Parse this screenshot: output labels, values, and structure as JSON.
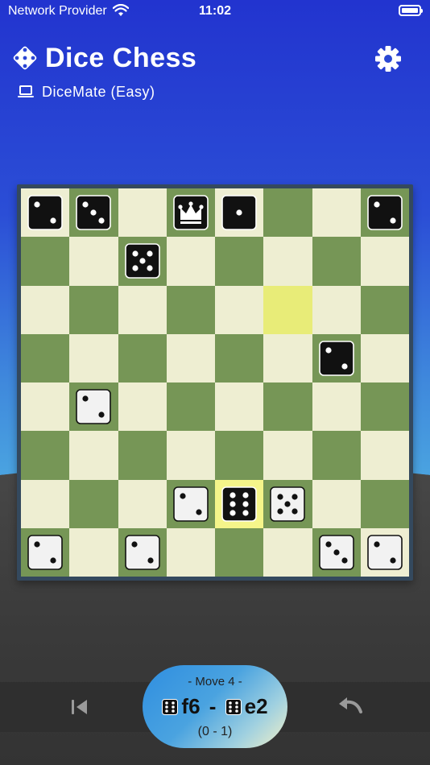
{
  "status_bar": {
    "carrier": "Network Provider",
    "time": "11:02"
  },
  "header": {
    "title": "Dice Chess",
    "opponent": "DiceMate (Easy)"
  },
  "colors": {
    "light_square": "#eeeed2",
    "dark_square": "#769656",
    "highlight_square": "#e8ec78",
    "selected_square": "#f5f58a",
    "board_frame": "#34495e"
  },
  "board": {
    "highlighted": [
      "f6"
    ],
    "selected": [
      "e2"
    ],
    "pieces": [
      {
        "square": "a8",
        "color": "black",
        "pips": 2
      },
      {
        "square": "b8",
        "color": "black",
        "pips": 3
      },
      {
        "square": "d8",
        "color": "black",
        "pips": 0,
        "icon": "crown-icon"
      },
      {
        "square": "e8",
        "color": "black",
        "pips": 1
      },
      {
        "square": "h8",
        "color": "black",
        "pips": 2
      },
      {
        "square": "c7",
        "color": "black",
        "pips": 5
      },
      {
        "square": "g5",
        "color": "black",
        "pips": 2
      },
      {
        "square": "b4",
        "color": "white",
        "pips": 2
      },
      {
        "square": "d2",
        "color": "white",
        "pips": 2
      },
      {
        "square": "e2",
        "color": "black",
        "pips": 6
      },
      {
        "square": "f2",
        "color": "white",
        "pips": 5
      },
      {
        "square": "a1",
        "color": "white",
        "pips": 2
      },
      {
        "square": "c1",
        "color": "white",
        "pips": 2
      },
      {
        "square": "g1",
        "color": "white",
        "pips": 3
      },
      {
        "square": "h1",
        "color": "white",
        "pips": 2
      }
    ]
  },
  "move_panel": {
    "move_label": "- Move 4 -",
    "from_square": "f6",
    "separator": " - ",
    "to_square": "e2",
    "from_die_pips": 6,
    "to_die_pips": 6,
    "score": "(0 - 1)"
  }
}
